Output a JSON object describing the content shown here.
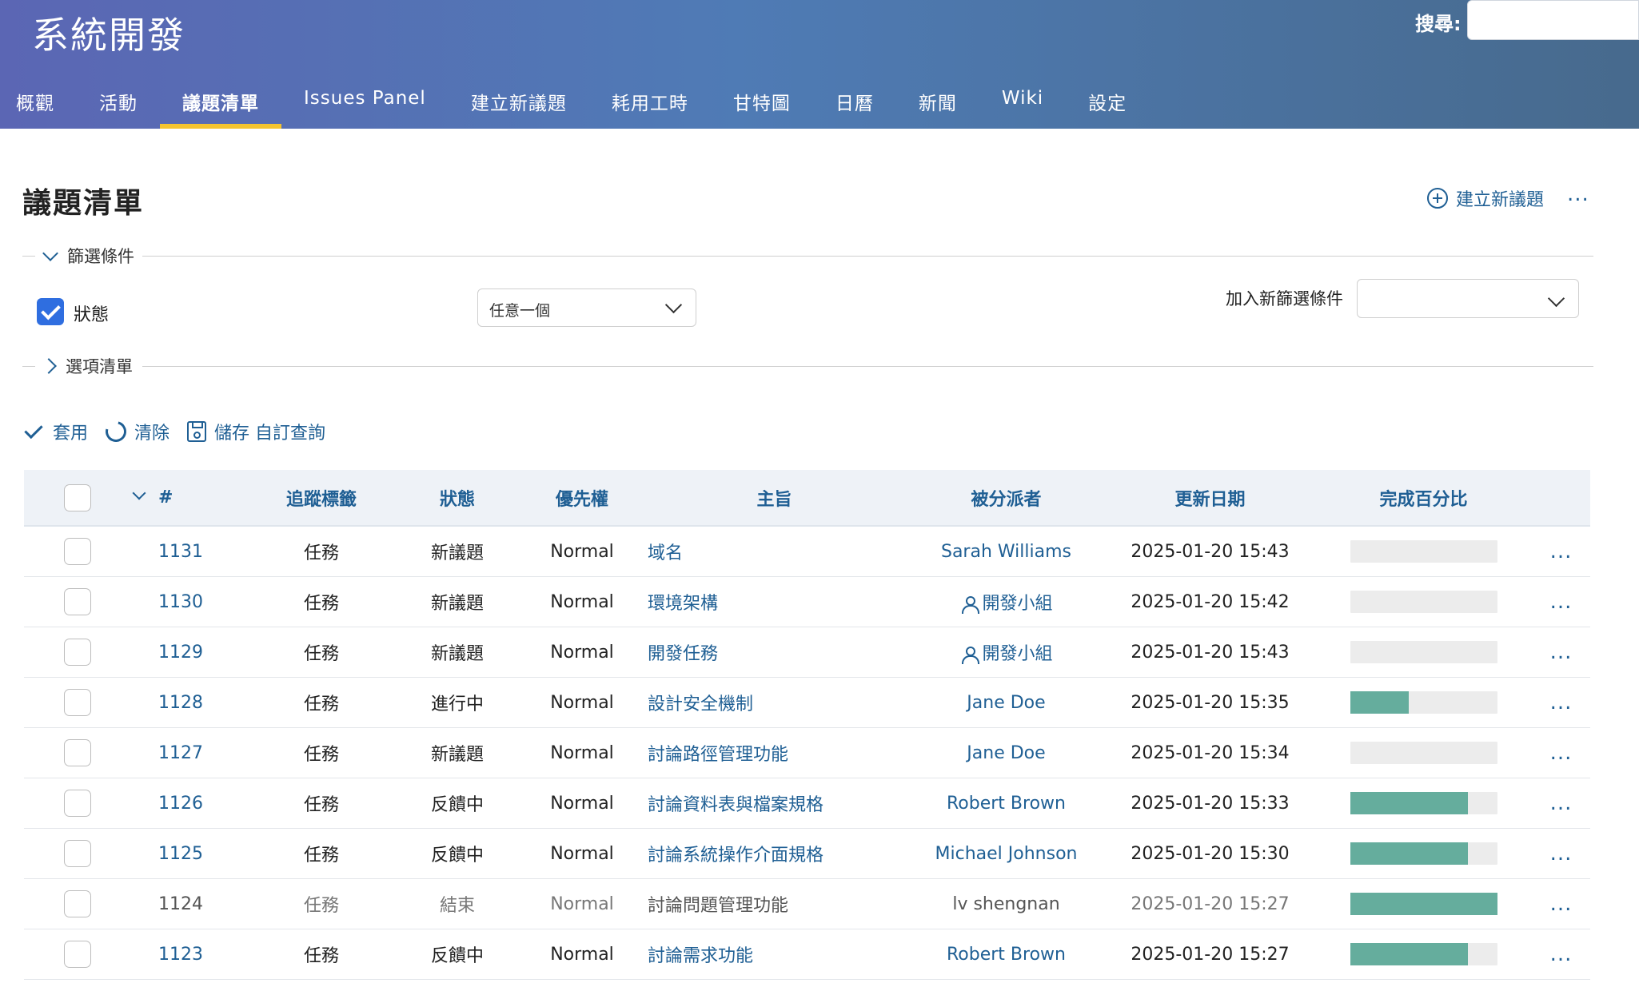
{
  "header": {
    "project_title": "系統開發",
    "search_label": "搜尋:",
    "search_value": ""
  },
  "menu": [
    {
      "label": "概觀",
      "selected": false
    },
    {
      "label": "活動",
      "selected": false
    },
    {
      "label": "議題清單",
      "selected": true
    },
    {
      "label": "Issues Panel",
      "selected": false
    },
    {
      "label": "建立新議題",
      "selected": false
    },
    {
      "label": "耗用工時",
      "selected": false
    },
    {
      "label": "甘特圖",
      "selected": false
    },
    {
      "label": "日曆",
      "selected": false
    },
    {
      "label": "新聞",
      "selected": false
    },
    {
      "label": "Wiki",
      "selected": false
    },
    {
      "label": "設定",
      "selected": false
    }
  ],
  "page": {
    "title": "議題清單",
    "new_issue_label": "建立新議題",
    "more_icon": "..."
  },
  "filters": {
    "legend": "篩選條件",
    "status_label": "狀態",
    "status_checked": true,
    "status_operator": "任意一個",
    "add_filter_label": "加入新篩選條件",
    "add_filter_value": ""
  },
  "options": {
    "legend": "選項清單"
  },
  "actions": {
    "apply": "套用",
    "clear": "清除",
    "save": "儲存 自訂查詢"
  },
  "table": {
    "columns": [
      "#",
      "追蹤標籤",
      "狀態",
      "優先權",
      "主旨",
      "被分派者",
      "更新日期",
      "完成百分比"
    ],
    "rows": [
      {
        "id": "1131",
        "tracker": "任務",
        "status": "新議題",
        "priority": "Normal",
        "subject": "域名",
        "assignee": "Sarah Williams",
        "group": false,
        "updated": "2025-01-20 15:43",
        "done": 0,
        "closed": false
      },
      {
        "id": "1130",
        "tracker": "任務",
        "status": "新議題",
        "priority": "Normal",
        "subject": "環境架構",
        "assignee": "開發小組",
        "group": true,
        "updated": "2025-01-20 15:42",
        "done": 0,
        "closed": false
      },
      {
        "id": "1129",
        "tracker": "任務",
        "status": "新議題",
        "priority": "Normal",
        "subject": "開發任務",
        "assignee": "開發小組",
        "group": true,
        "updated": "2025-01-20 15:43",
        "done": 0,
        "closed": false
      },
      {
        "id": "1128",
        "tracker": "任務",
        "status": "進行中",
        "priority": "Normal",
        "subject": "設計安全機制",
        "assignee": "Jane Doe",
        "group": false,
        "updated": "2025-01-20 15:35",
        "done": 40,
        "closed": false
      },
      {
        "id": "1127",
        "tracker": "任務",
        "status": "新議題",
        "priority": "Normal",
        "subject": "討論路徑管理功能",
        "assignee": "Jane Doe",
        "group": false,
        "updated": "2025-01-20 15:34",
        "done": 0,
        "closed": false
      },
      {
        "id": "1126",
        "tracker": "任務",
        "status": "反饋中",
        "priority": "Normal",
        "subject": "討論資料表與檔案規格",
        "assignee": "Robert Brown",
        "group": false,
        "updated": "2025-01-20 15:33",
        "done": 80,
        "closed": false
      },
      {
        "id": "1125",
        "tracker": "任務",
        "status": "反饋中",
        "priority": "Normal",
        "subject": "討論系統操作介面規格",
        "assignee": "Michael Johnson",
        "group": false,
        "updated": "2025-01-20 15:30",
        "done": 80,
        "closed": false
      },
      {
        "id": "1124",
        "tracker": "任務",
        "status": "結束",
        "priority": "Normal",
        "subject": "討論問題管理功能",
        "assignee": "lv shengnan",
        "group": false,
        "updated": "2025-01-20 15:27",
        "done": 100,
        "closed": true
      },
      {
        "id": "1123",
        "tracker": "任務",
        "status": "反饋中",
        "priority": "Normal",
        "subject": "討論需求功能",
        "assignee": "Robert Brown",
        "group": false,
        "updated": "2025-01-20 15:27",
        "done": 80,
        "closed": false
      }
    ]
  },
  "colors": {
    "header_start": "#5b66b4",
    "header_end": "#476a8d",
    "selected_tab_underline": "#f4c430",
    "link": "#1f5f94",
    "progress_fill": "#65ad9d",
    "checkbox_checked": "#2f6ee0"
  }
}
